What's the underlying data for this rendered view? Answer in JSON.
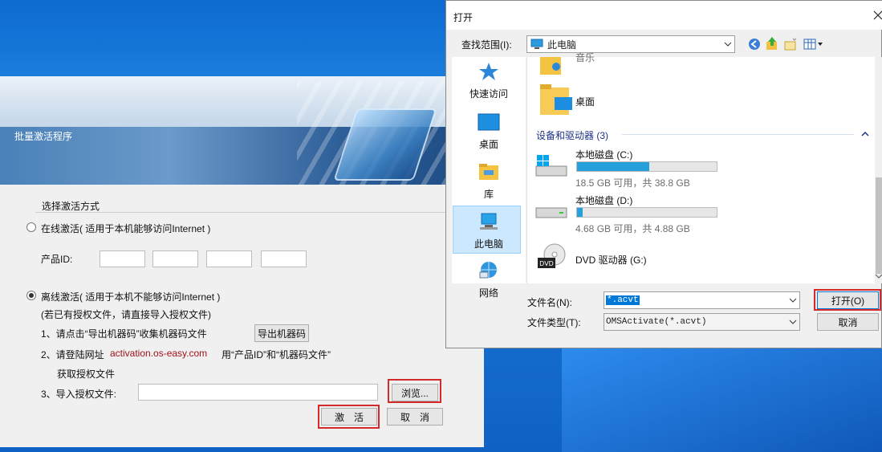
{
  "activation_window": {
    "title": "批量激活程序",
    "group_title": "选择激活方式",
    "online_option": "在线激活( 适用于本机能够访问Internet )",
    "product_id_label": "产品ID:",
    "offline_option": "离线激活( 适用于本机不能够访问Internet )",
    "offline_note": "(若已有授权文件，请直接导入授权文件)",
    "step1": "1、请点击“导出机器码”收集机器码文件",
    "export_button": "导出机器码",
    "step2_prefix": "2、请登陆网址",
    "step2_url": "activation.os-easy.com",
    "step2_suffix": "用“产品ID”和“机器码文件”",
    "step2_cont": "获取授权文件",
    "step3": "3、导入授权文件:",
    "browse_button": "浏览...",
    "activate_button": "激　活",
    "cancel_button": "取　消",
    "online_selected": false,
    "offline_selected": true
  },
  "open_dialog": {
    "title": "打开",
    "lookin_label": "查找范围(I):",
    "lookin_value": "此电脑",
    "nav": [
      "快速访问",
      "桌面",
      "库",
      "此电脑",
      "网络"
    ],
    "selected_nav": "此电脑",
    "partial_item": "音乐",
    "desktop_item": "桌面",
    "group_header": "设备和驱动器 (3)",
    "drives": [
      {
        "name": "本地磁盘 (C:)",
        "detail": "18.5 GB 可用，共 38.8 GB",
        "used_fraction": 0.52
      },
      {
        "name": "本地磁盘 (D:)",
        "detail": "4.68 GB 可用，共 4.88 GB",
        "used_fraction": 0.04
      },
      {
        "name": "DVD 驱动器 (G:)",
        "detail": ""
      }
    ],
    "filename_label": "文件名(N):",
    "filename_value": "*.acvt",
    "filetype_label": "文件类型(T):",
    "filetype_value": "OMSActivate(*.acvt)",
    "open_button": "打开(O)",
    "cancel_button": "取消"
  }
}
